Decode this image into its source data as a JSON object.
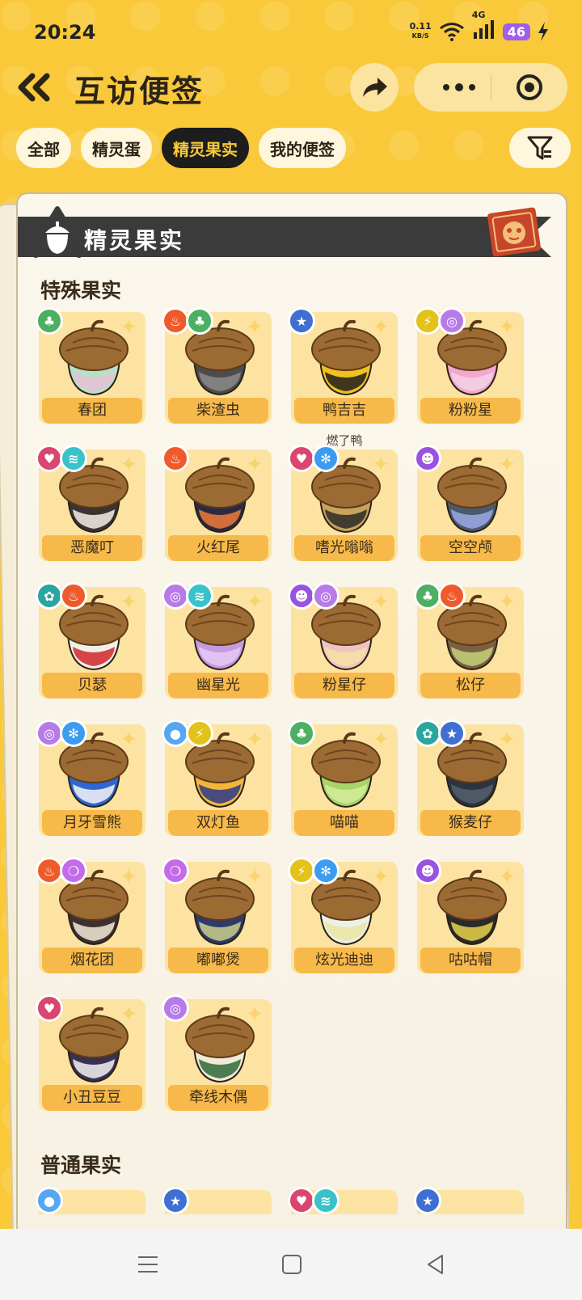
{
  "status": {
    "time": "20:24",
    "net_speed_value": "0.11",
    "net_speed_unit": "KB/S",
    "network": "4G",
    "battery": "46"
  },
  "header": {
    "title": "互访便签"
  },
  "tabs": [
    {
      "label": "全部",
      "active": false
    },
    {
      "label": "精灵蛋",
      "active": false
    },
    {
      "label": "精灵果实",
      "active": true
    },
    {
      "label": "我的便签",
      "active": false
    }
  ],
  "card": {
    "banner_title": "精灵果实",
    "section_special": "特殊果实",
    "section_normal": "普通果实"
  },
  "colors": {
    "grass": "#4caf62",
    "fire": "#ef5a2b",
    "light": "#3f6fd1",
    "electric": "#e3c21a",
    "wind": "#b67be6",
    "demon": "#d94670",
    "wing": "#39c2c9",
    "ice": "#3d9cf0",
    "ghost": "#9a52e0",
    "mech": "#2aa5a0",
    "bubble": "#c46be8",
    "water": "#56a6f2"
  },
  "items": [
    {
      "name": "春团",
      "badges": [
        "grass"
      ],
      "cap": "#9c6a33",
      "body": "#b8e0c8",
      "accent": "#e7bfd3"
    },
    {
      "name": "柴渣虫",
      "badges": [
        "fire",
        "grass"
      ],
      "cap": "#9c6a33",
      "body": "#4c4c4c",
      "accent": "#8a8a8a"
    },
    {
      "name": "鸭吉吉",
      "badges": [
        "light"
      ],
      "cap": "#9c6a33",
      "body": "#f0c21e",
      "accent": "#1e1e1e",
      "note": "燃了鸭"
    },
    {
      "name": "粉粉星",
      "badges": [
        "electric",
        "wind"
      ],
      "cap": "#9c6a33",
      "body": "#f2a7cf",
      "accent": "#f4d2e5"
    },
    {
      "name": "恶魔叮",
      "badges": [
        "demon",
        "wing"
      ],
      "cap": "#9c6a33",
      "body": "#3b3232",
      "accent": "#f3efe6"
    },
    {
      "name": "火红尾",
      "badges": [
        "fire"
      ],
      "cap": "#9c6a33",
      "body": "#2a2a44",
      "accent": "#ef7a3a"
    },
    {
      "name": "嗜光嗡嗡",
      "badges": [
        "demon",
        "ice"
      ],
      "cap": "#9c6a33",
      "body": "#c8a45a",
      "accent": "#2a2a2a"
    },
    {
      "name": "空空颅",
      "badges": [
        "ghost"
      ],
      "cap": "#9c6a33",
      "body": "#4a5a6c",
      "accent": "#9ca8e6"
    },
    {
      "name": "贝瑟",
      "badges": [
        "mech",
        "fire"
      ],
      "cap": "#9c6a33",
      "body": "#f2efe6",
      "accent": "#d2262a"
    },
    {
      "name": "幽星光",
      "badges": [
        "wind",
        "wing"
      ],
      "cap": "#9c6a33",
      "body": "#c79ae0",
      "accent": "#e5c9f2"
    },
    {
      "name": "粉星仔",
      "badges": [
        "ghost",
        "wind"
      ],
      "cap": "#9c6a33",
      "body": "#f0c3c3",
      "accent": "#f6e2a2"
    },
    {
      "name": "松仔",
      "badges": [
        "grass",
        "fire"
      ],
      "cap": "#9c6a33",
      "body": "#7a6040",
      "accent": "#c4d27a"
    },
    {
      "name": "月牙雪熊",
      "badges": [
        "wind",
        "ice"
      ],
      "cap": "#9c6a33",
      "body": "#2f66d6",
      "accent": "#f4f4f4"
    },
    {
      "name": "双灯鱼",
      "badges": [
        "water",
        "electric"
      ],
      "cap": "#9c6a33",
      "body": "#f2b63a",
      "accent": "#2b3a8a"
    },
    {
      "name": "喵喵",
      "badges": [
        "grass"
      ],
      "cap": "#9c6a33",
      "body": "#a8d46a",
      "accent": "#d6ec9a"
    },
    {
      "name": "猴麦仔",
      "badges": [
        "mech",
        "light"
      ],
      "cap": "#9c6a33",
      "body": "#2c3440",
      "accent": "#55606e"
    },
    {
      "name": "烟花团",
      "badges": [
        "fire",
        "bubble"
      ],
      "cap": "#9c6a33",
      "body": "#3c3030",
      "accent": "#f2ead6"
    },
    {
      "name": "嘟嘟煲",
      "badges": [
        "bubble"
      ],
      "cap": "#9c6a33",
      "body": "#2e3a6a",
      "accent": "#c9d08a"
    },
    {
      "name": "炫光迪迪",
      "badges": [
        "electric",
        "ice"
      ],
      "cap": "#9c6a33",
      "body": "#eef0e6",
      "accent": "#e9e6a2"
    },
    {
      "name": "咕咕帽",
      "badges": [
        "ghost"
      ],
      "cap": "#9c6a33",
      "body": "#2a2a2a",
      "accent": "#e6d24a"
    },
    {
      "name": "小丑豆豆",
      "badges": [
        "demon"
      ],
      "cap": "#9c6a33",
      "body": "#3a3050",
      "accent": "#f2f2f2"
    },
    {
      "name": "牵线木偶",
      "badges": [
        "wind"
      ],
      "cap": "#9c6a33",
      "body": "#f2ead6",
      "accent": "#2e6a3a"
    }
  ],
  "normal_peek": [
    [
      "water"
    ],
    [
      "light"
    ],
    [
      "demon",
      "wing"
    ],
    [
      "light"
    ]
  ]
}
